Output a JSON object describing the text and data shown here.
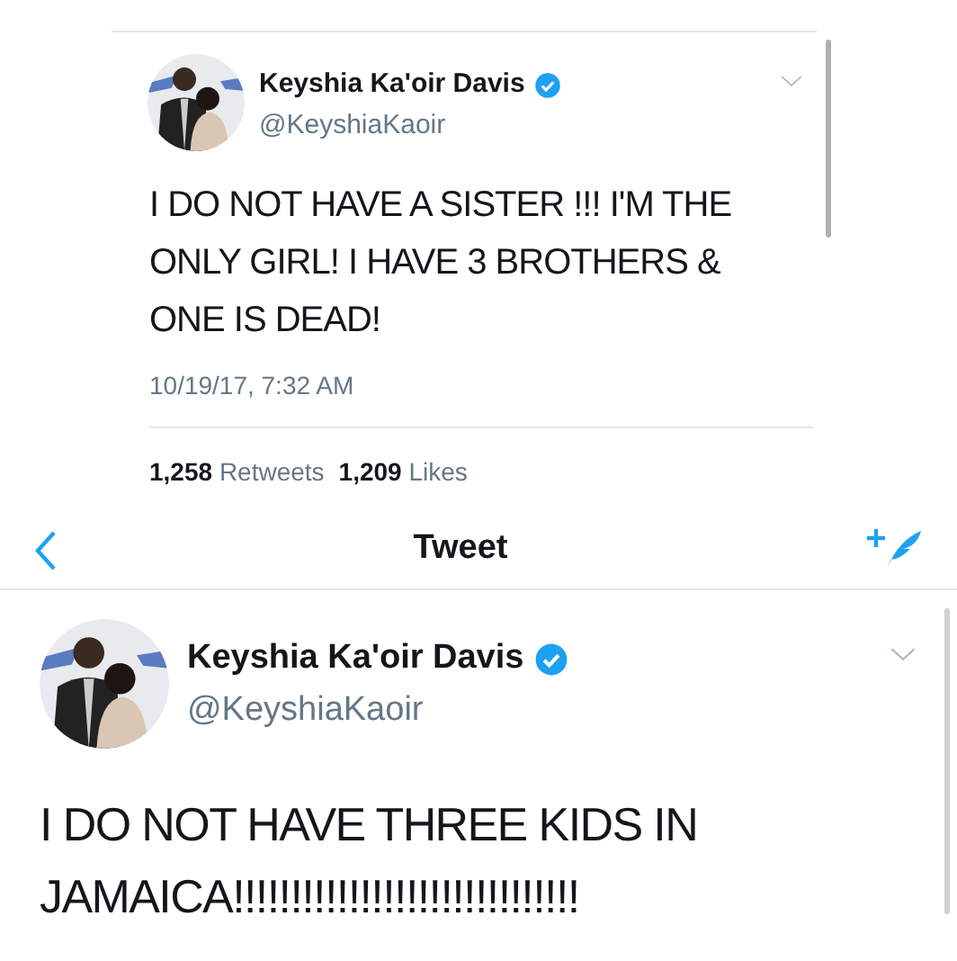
{
  "top_tweet": {
    "author": {
      "name": "Keyshia Ka'oir Davis",
      "verified": true,
      "handle": "@KeyshiaKaoir"
    },
    "text": "I DO NOT HAVE A SISTER !!! I'M THE ONLY GIRL! I HAVE 3 BROTHERS & ONE IS DEAD!",
    "timestamp": "10/19/17, 7:32 AM",
    "stats": [
      {
        "count": "1,258",
        "label": "Retweets"
      },
      {
        "count": "1,209",
        "label": "Likes"
      }
    ]
  },
  "bottom_screen": {
    "nav": {
      "title": "Tweet"
    },
    "tweet": {
      "author": {
        "name": "Keyshia Ka'oir Davis",
        "verified": true,
        "handle": "@KeyshiaKaoir"
      },
      "text": "I DO NOT HAVE THREE KIDS IN JAMAICA!!!!!!!!!!!!!!!!!!!!!!!!!!!!!!"
    }
  }
}
